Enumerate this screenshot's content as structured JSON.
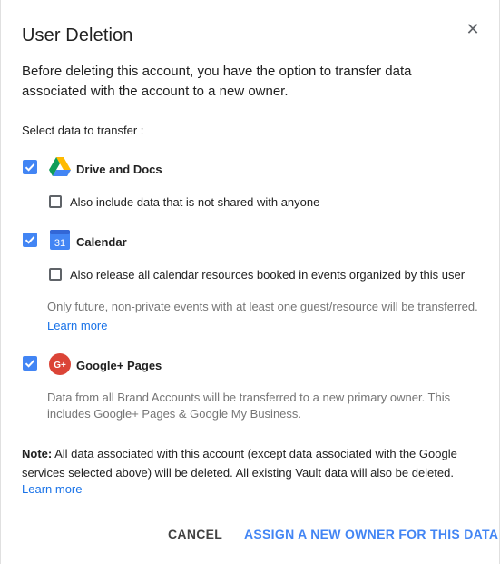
{
  "dialog": {
    "title": "User Deletion",
    "intro": "Before deleting this account, you have the option to transfer data associated with the account to a new owner.",
    "select_label": "Select data to transfer :"
  },
  "services": {
    "drive": {
      "label": "Drive and Docs",
      "checked": true,
      "icon": "google-drive-icon",
      "sub_option": {
        "label": "Also include data that is not shared with anyone",
        "checked": false
      }
    },
    "calendar": {
      "label": "Calendar",
      "checked": true,
      "icon": "google-calendar-icon",
      "icon_text": "31",
      "sub_option": {
        "label": "Also release all calendar resources booked in events organized by this user",
        "checked": false
      },
      "help": "Only future, non-private events with at least one guest/resource will be transferred.",
      "link": "Learn more"
    },
    "gplus": {
      "label": "Google+ Pages",
      "checked": true,
      "icon": "google-plus-icon",
      "icon_text": "G+",
      "help": "Data from all Brand Accounts will be transferred to a new primary owner. This includes Google+ Pages & Google My Business."
    }
  },
  "note": {
    "prefix": "Note:",
    "text": " All data associated with this account (except data associated with the Google services selected above) will be deleted. All existing Vault data will also be deleted.",
    "link": "Learn more"
  },
  "actions": {
    "cancel": "CANCEL",
    "assign": "ASSIGN A NEW OWNER FOR THIS DATA"
  },
  "colors": {
    "accent": "#4285f4",
    "link": "#1a73e8",
    "help_text": "#757575"
  }
}
